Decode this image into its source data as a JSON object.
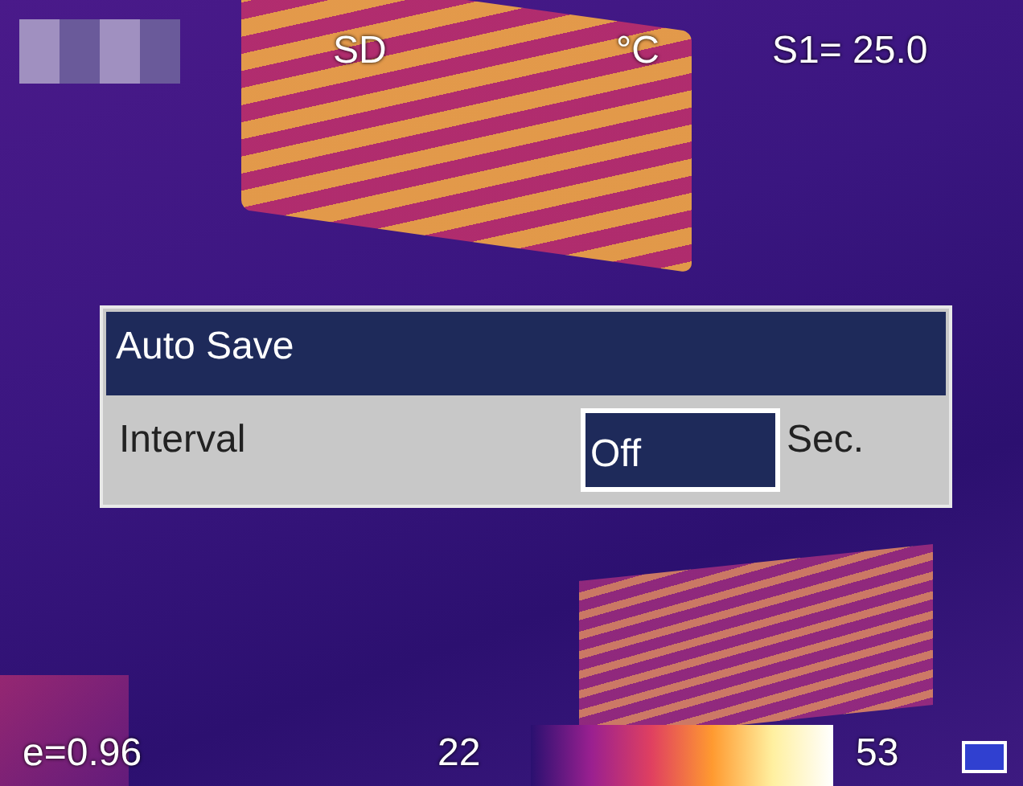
{
  "top_bar": {
    "storage": "SD",
    "unit": "°C",
    "spot": "S1= 25.0"
  },
  "dialog": {
    "title": "Auto Save",
    "rows": [
      {
        "label": "Interval",
        "value": "Off",
        "unit": "Sec."
      }
    ]
  },
  "bottom_bar": {
    "emissivity": "e=0.96",
    "min": "22",
    "max": "53"
  }
}
